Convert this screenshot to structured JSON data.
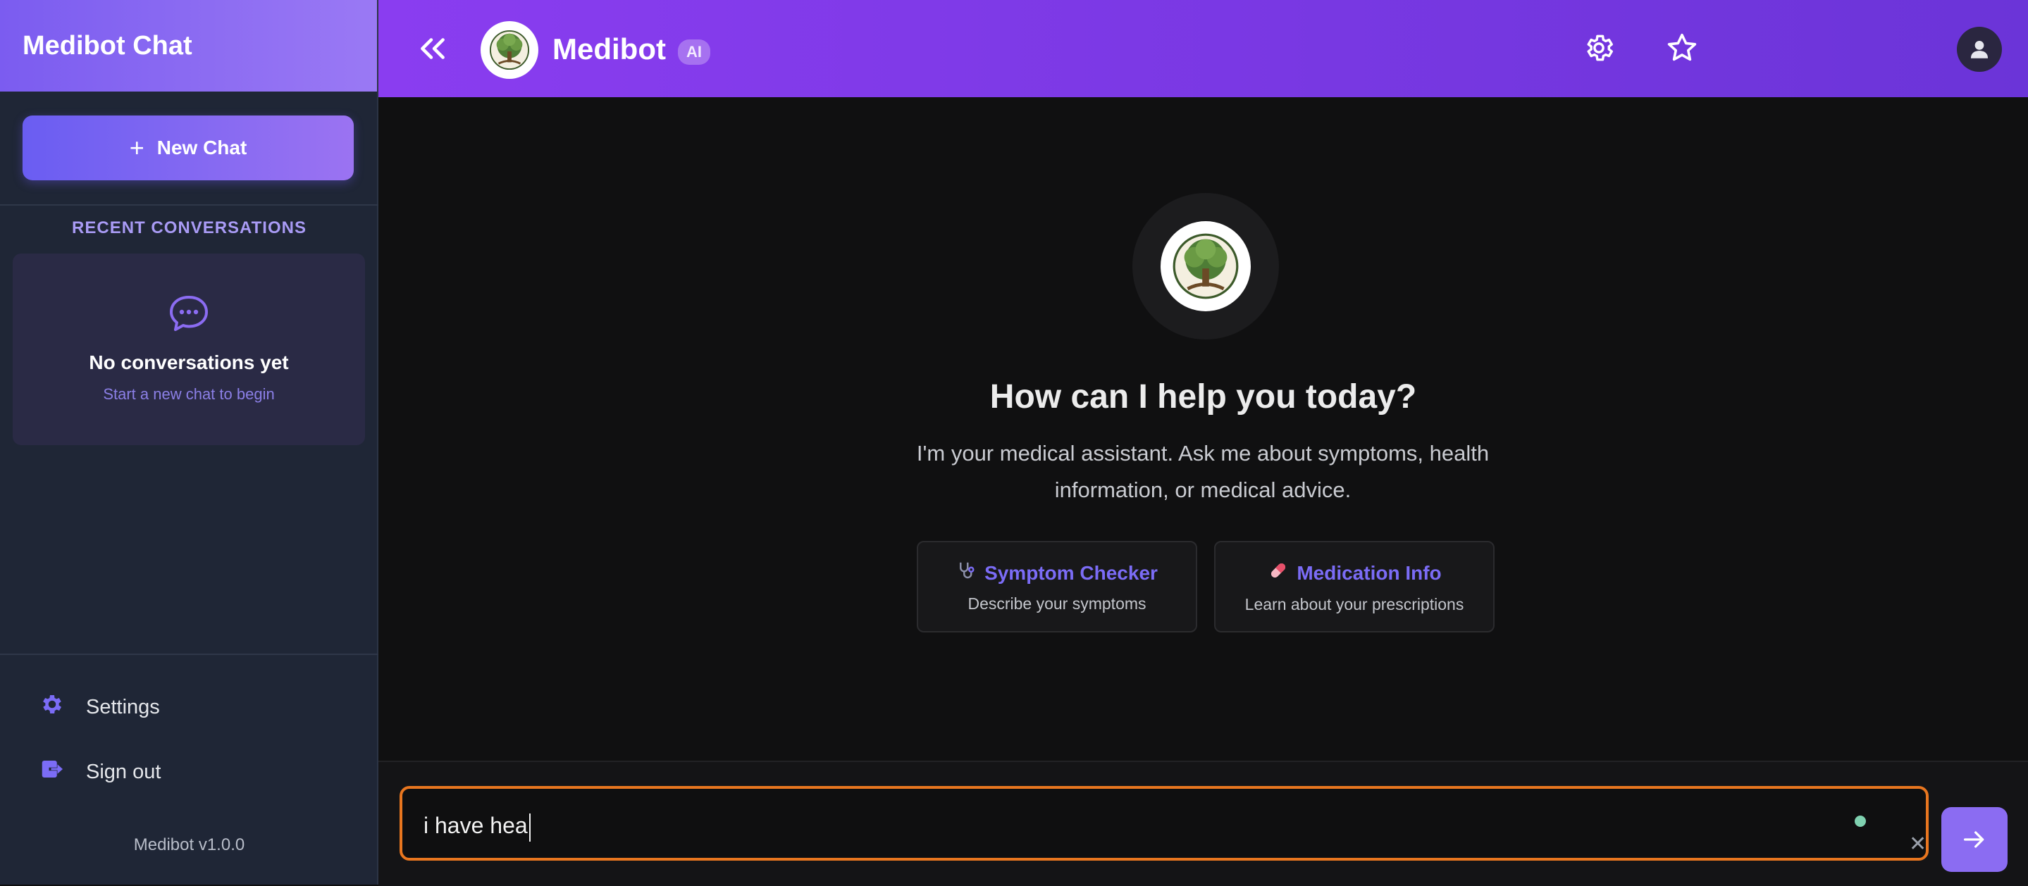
{
  "sidebar": {
    "title": "Medibot Chat",
    "new_chat_label": "New Chat",
    "recent_title": "RECENT CONVERSATIONS",
    "empty_title": "No conversations yet",
    "empty_subtitle": "Start a new chat to begin",
    "nav": [
      {
        "label": "Settings",
        "icon": "gear-icon"
      },
      {
        "label": "Sign out",
        "icon": "sign-out-icon"
      }
    ],
    "version": "Medibot v1.0.0"
  },
  "topbar": {
    "brand": "Medibot",
    "badge": "AI",
    "icons": [
      "chevrons-left-icon",
      "settings-icon",
      "star-icon",
      "user-icon"
    ]
  },
  "hero": {
    "title": "How can I help you today?",
    "subtitle": "I'm your medical assistant. Ask me about symptoms, health information, or medical advice."
  },
  "quick_actions": [
    {
      "title": "Symptom Checker",
      "subtitle": "Describe your symptoms",
      "icon": "stethoscope-icon"
    },
    {
      "title": "Medication Info",
      "subtitle": "Learn about your prescriptions",
      "icon": "pill-icon"
    }
  ],
  "input": {
    "value": "i have hea"
  },
  "colors": {
    "accent": "#8b6cf2",
    "topbar_start": "#8a3df0",
    "topbar_end": "#6b34d8",
    "input_focus": "#e8761f",
    "background": "#101011",
    "sidebar": "#1f2636"
  }
}
